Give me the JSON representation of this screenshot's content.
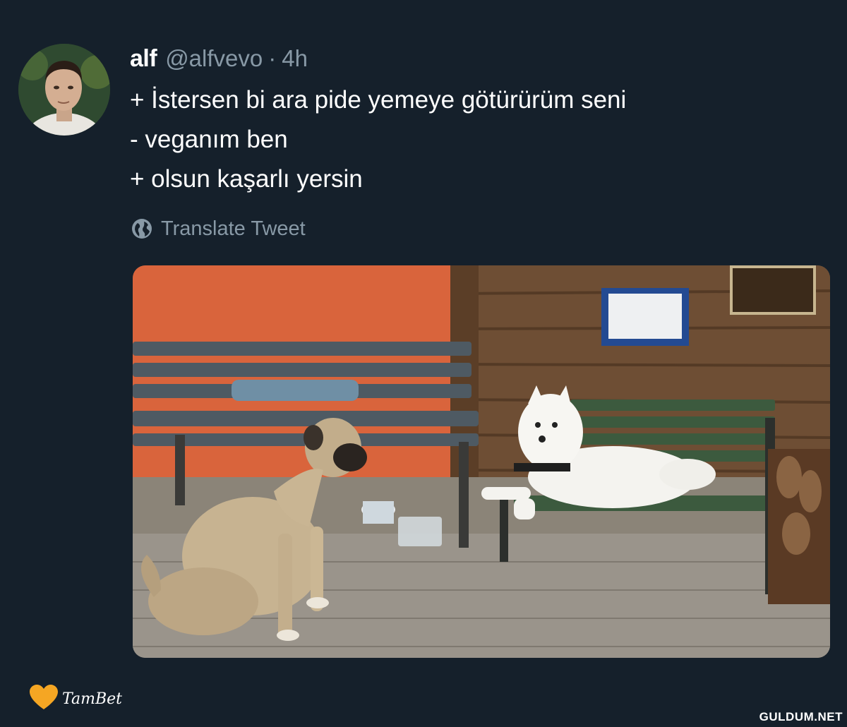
{
  "tweet": {
    "author": {
      "display_name": "alf",
      "handle": "@alfvevo",
      "avatar_icon": "user-avatar-photo"
    },
    "separator": "·",
    "timestamp": "4h",
    "lines": [
      "+ İstersen bi ara pide yemeye götürürüm seni",
      "- veganım ben",
      "+ olsun kaşarlı yersin"
    ],
    "translate": {
      "icon": "globe-icon",
      "label": "Translate Tweet"
    },
    "media": {
      "type": "photo",
      "icon": "photo-image"
    }
  },
  "footer": {
    "brand_logo_text": "TamBet",
    "brand_icon": "heart-icon",
    "brand_color": "#f5a623",
    "watermark": "GULDUM.NET"
  },
  "colors": {
    "background": "#15202b",
    "primary_text": "#ffffff",
    "secondary_text": "#8899a6"
  }
}
